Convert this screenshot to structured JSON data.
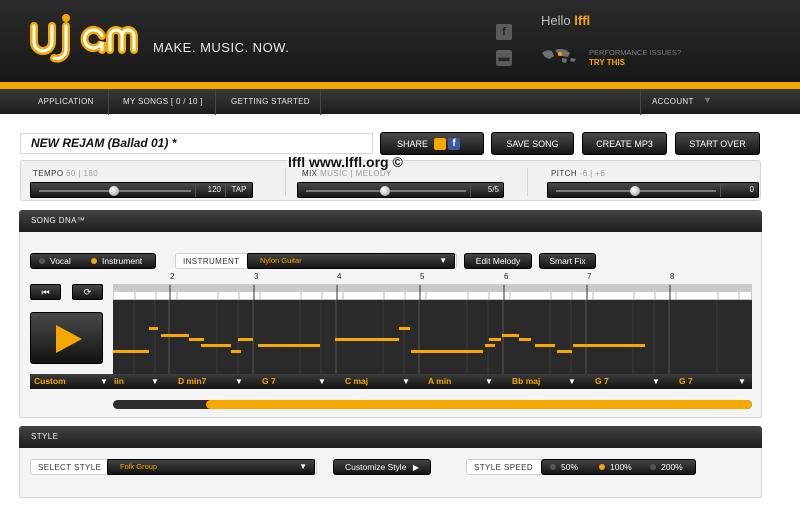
{
  "header": {
    "tagline": "MAKE. MUSIC. NOW.",
    "hello_label": "Hello",
    "username": "lffl",
    "perf_line1": "PERFORMANCE ISSUES?",
    "perf_link": "TRY THIS"
  },
  "nav": {
    "application": "APPLICATION",
    "my_songs": "MY SONGS [ 0 / 10 ]",
    "getting_started": "GETTING STARTED",
    "account": "ACCOUNT"
  },
  "song": {
    "title": "NEW REJAM (Ballad 01) *"
  },
  "toolbar": {
    "share": "SHARE",
    "save": "SAVE SONG",
    "create_mp3": "CREATE MP3",
    "start_over": "START OVER"
  },
  "params": {
    "tempo_label": "TEMPO",
    "tempo_range": "60 | 180",
    "tempo_value": "120",
    "tempo_fraction": 0.5,
    "tap": "TAP",
    "mix_label": "MIX",
    "mix_range": "MUSIC | MELODY",
    "mix_value": "5/5",
    "mix_fraction": 0.5,
    "pitch_label": "PITCH",
    "pitch_range": "-6 | +6",
    "pitch_value": "0",
    "pitch_fraction": 0.5
  },
  "watermark": "lffl www.lffl.org ©",
  "song_dna": {
    "header": "SONG DNA™",
    "vocal": "Vocal",
    "instrument": "Instrument",
    "instrument_label": "INSTRUMENT",
    "instrument_value": "Nylon Guitar",
    "edit_melody": "Edit Melody",
    "smart_fix": "Smart Fix",
    "bar_numbers": [
      "2",
      "3",
      "4",
      "5",
      "6",
      "7",
      "8"
    ],
    "chords": [
      "Custom",
      "iin",
      "D min7",
      "G 7",
      "C maj",
      "A min",
      "Bb maj",
      "G 7",
      "G 7"
    ],
    "progress_start": 0.145,
    "progress_end": 1.0
  },
  "style": {
    "header": "STYLE",
    "select_label": "SELECT STYLE",
    "style_value": "Folk Group",
    "customize": "Customize Style",
    "speed_label": "STYLE SPEED",
    "speeds": [
      "50%",
      "100%",
      "200%"
    ],
    "speed_selected": "100%"
  },
  "icons": {
    "play": "play-icon",
    "rewind": "skip-back-icon",
    "loop": "loop-icon",
    "facebook": "facebook-icon",
    "soundcloud": "soundcloud-icon",
    "world": "world-map-icon"
  },
  "colors": {
    "accent": "#f4a800",
    "dark": "#1c1c1c"
  }
}
